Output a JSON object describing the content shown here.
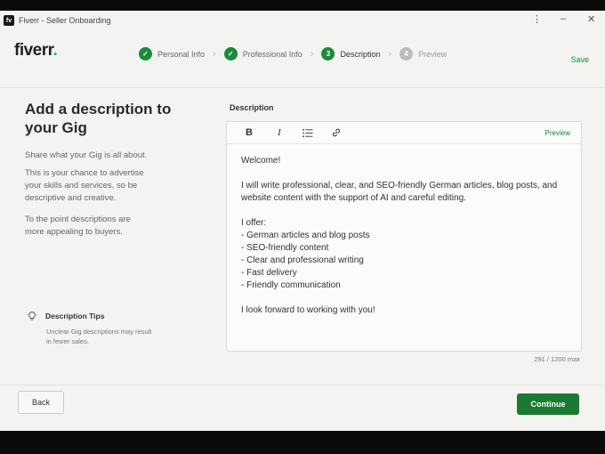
{
  "window": {
    "app_icon_text": "fv",
    "title": "Fiverr - Seller Onboarding",
    "controls": {
      "more": "⋮",
      "minimize": "–",
      "close": "✕"
    }
  },
  "header": {
    "logo_text": "fiverr",
    "logo_dot": ".",
    "save_label": "Save",
    "steps": [
      {
        "number": "✓",
        "label": "Personal Info",
        "state": "done"
      },
      {
        "number": "✓",
        "label": "Professional Info",
        "state": "done"
      },
      {
        "number": "3",
        "label": "Description",
        "state": "current"
      },
      {
        "number": "4",
        "label": "Preview",
        "state": "future"
      }
    ],
    "separator": "›"
  },
  "left": {
    "heading": "Add a description to your Gig",
    "paragraphs": [
      "Share what your Gig is all about.",
      "This is your chance to advertise your skills and services, so be descriptive and creative.",
      "To the point descriptions are more appealing to buyers."
    ],
    "tips_title": "Description Tips",
    "tips_text": "Unclear Gig descriptions may result in fewer sales."
  },
  "editor": {
    "label": "Description",
    "toolbar": {
      "bold": "B",
      "italic": "I",
      "preview": "Preview"
    },
    "text": "Welcome!\n\nI will write professional, clear, and SEO-friendly German articles, blog posts, and website content with the support of AI and careful editing.\n\nI offer:\n- German articles and blog posts\n- SEO-friendly content\n- Clear and professional writing\n- Fast delivery\n- Friendly communication\n\nI look forward to working with you!",
    "counter": "291 / 1200 max"
  },
  "footer": {
    "back_label": "Back",
    "continue_label": "Continue"
  },
  "colors": {
    "brand_green": "#1a8a3c",
    "continue_green": "#1a7a32",
    "logo_dot": "#1dbf73"
  }
}
